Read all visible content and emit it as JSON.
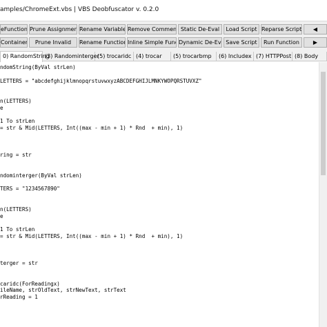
{
  "window": {
    "title": "amples/ChromeExt.vbs | VBS Deobfuscator v. 0.2.0"
  },
  "toolbar": {
    "row1": [
      "eFunctions",
      "Prune Assignments",
      "Rename Variables",
      "Remove Comments",
      "Static De-Eval",
      "Load Script",
      "Reparse Script",
      "◀"
    ],
    "row2": [
      "Containers",
      "Prune Invalid",
      "Rename Functions",
      "Inline Simple Funcs",
      "Dynamic De-Eval",
      "Save Script",
      "Run Function",
      "▶"
    ]
  },
  "tabs": [
    "0) RandomString",
    "(3) Randominterger",
    "(5) trocaridc",
    "(4) trocar",
    "(5) trocarbmp",
    "(6) Includex",
    "(7) HTTPPost",
    "(8) Body"
  ],
  "code_lines": [
    "ndomString(ByVal strLen)",
    "",
    "LETTERS = \"abcdefghijklmnopqrstuvwxyzABCDEFGHIJLMNKYWOPQRSTUVXZ\"",
    "",
    "",
    "n(LETTERS)",
    "e",
    "",
    "1 To strLen",
    "= str & Mid(LETTERS, Int((max - min + 1) * Rnd  + min), 1)",
    "",
    "",
    "",
    "ring = str",
    "",
    "",
    "ndominterger(ByVal strLen)",
    "",
    "TERS = \"1234567890\"",
    "",
    "",
    "n(LETTERS)",
    "e",
    "",
    "1 To strLen",
    "= str & Mid(LETTERS, Int((max - min + 1) * Rnd  + min), 1)",
    "",
    "",
    "",
    "terger = str",
    "",
    "",
    "caridc(ForReadingx)",
    "ileName, strOldText, strNewText, strText",
    "rReading = 1"
  ]
}
